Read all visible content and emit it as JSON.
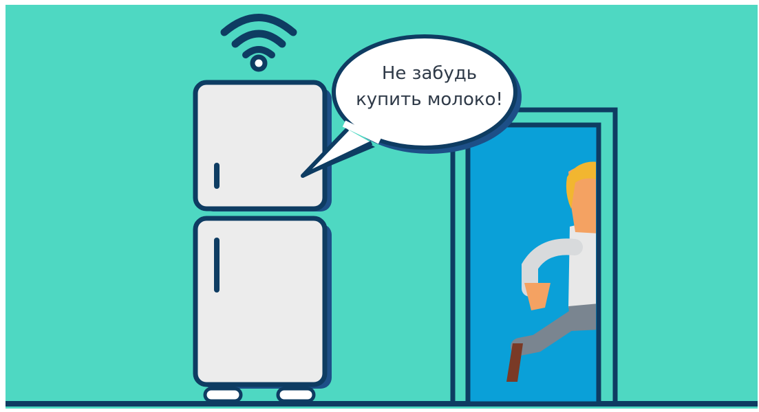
{
  "speech_bubble": {
    "line1": "Не забудь",
    "line2": "купить молоко!"
  },
  "colors": {
    "background": "#4ed8c2",
    "outline": "#0e3c62",
    "fridge_body": "#ececec",
    "fridge_shadow": "#1d4f87",
    "door_inside": "#0aa0d8",
    "floor": "#0e3c62",
    "hair": "#f2b630",
    "skin": "#f4a262",
    "shirt": "#e8e8e8",
    "pants": "#7a8590",
    "shoe": "#7a3a26"
  },
  "icons": {
    "wifi": "wifi-icon"
  }
}
